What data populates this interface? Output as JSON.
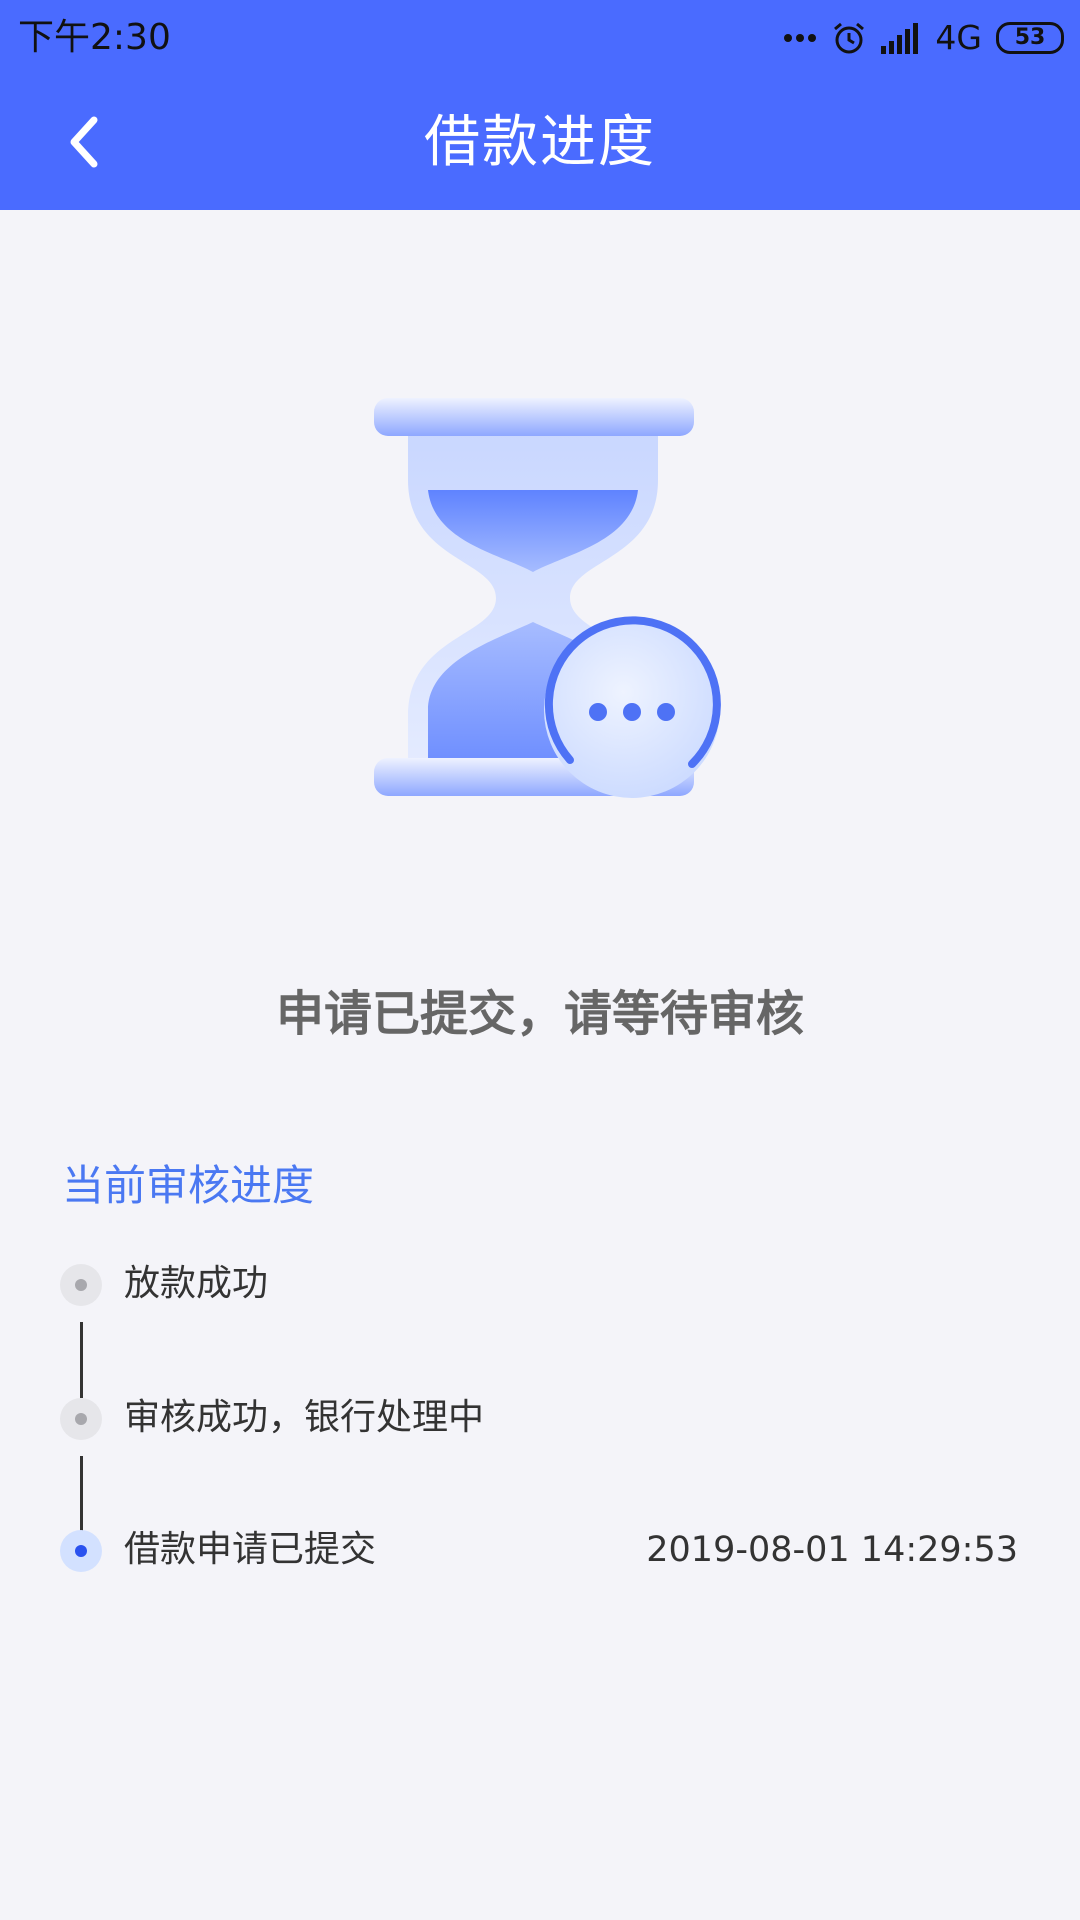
{
  "status_bar": {
    "time": "下午2:30",
    "network": "4G",
    "battery": "53"
  },
  "nav": {
    "title": "借款进度",
    "back_icon": "chevron-left-icon"
  },
  "illustration": {
    "icon": "hourglass-icon",
    "badge_icon": "more-dots-icon"
  },
  "status_message": "申请已提交，请等待审核",
  "progress": {
    "section_title": "当前审核进度",
    "steps": [
      {
        "label": "放款成功",
        "time": "",
        "active": false
      },
      {
        "label": "审核成功，银行处理中",
        "time": "",
        "active": false
      },
      {
        "label": "借款申请已提交",
        "time": "2019-08-01 14:29:53",
        "active": true
      }
    ]
  },
  "colors": {
    "header": "#4a6bff",
    "accent_text": "#4a78f2",
    "active_dot": "#2a52ef",
    "background": "#f4f4f9"
  }
}
